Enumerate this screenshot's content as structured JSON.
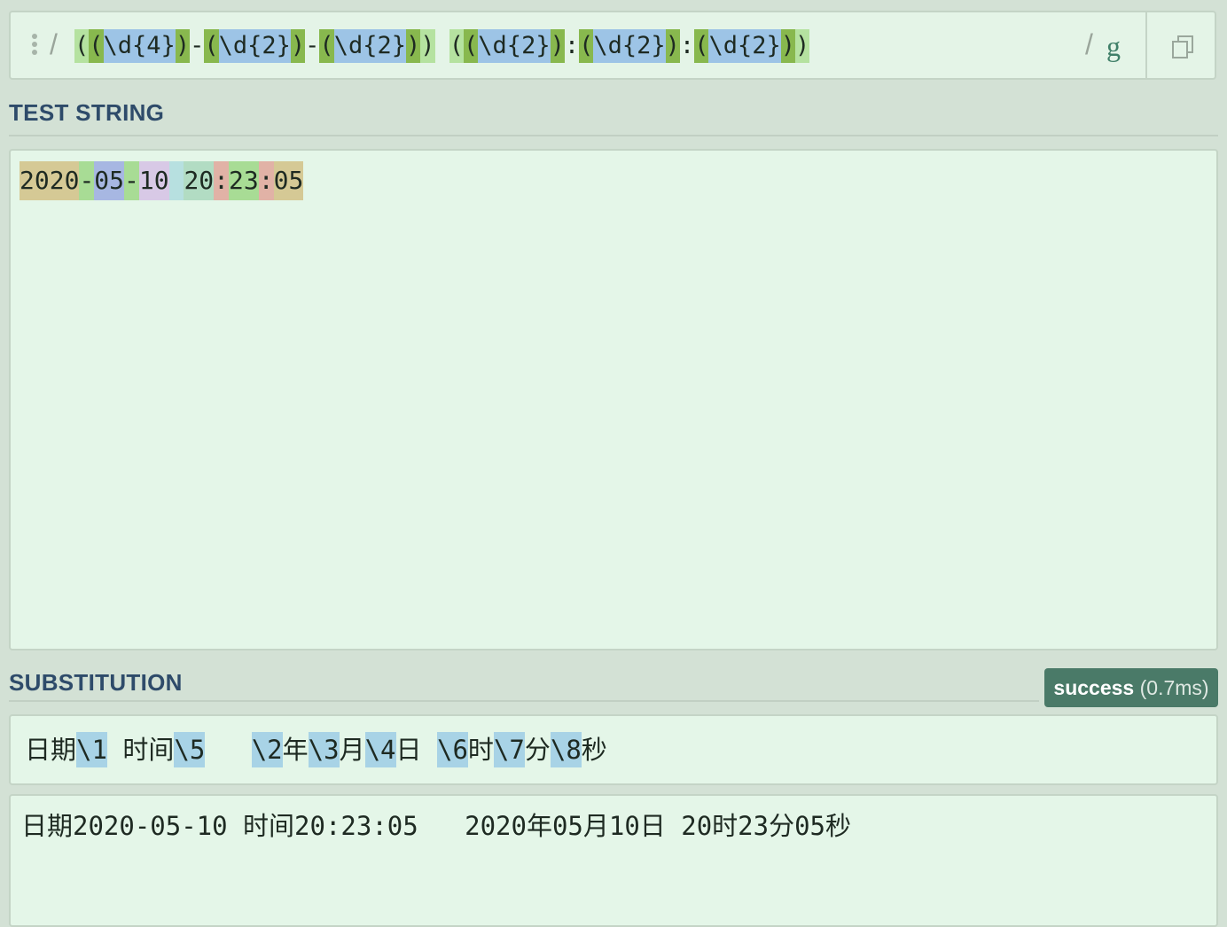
{
  "regex": {
    "open_delimiter": "/",
    "close_delimiter": "/",
    "flags": "g",
    "tokens": [
      {
        "text": "(",
        "kind": "outer"
      },
      {
        "text": "(",
        "kind": "inner"
      },
      {
        "text": "\\d{4}",
        "kind": "body"
      },
      {
        "text": ")",
        "kind": "inner"
      },
      {
        "text": "-",
        "kind": "lit"
      },
      {
        "text": "(",
        "kind": "inner"
      },
      {
        "text": "\\d{2}",
        "kind": "body"
      },
      {
        "text": ")",
        "kind": "inner"
      },
      {
        "text": "-",
        "kind": "lit"
      },
      {
        "text": "(",
        "kind": "inner"
      },
      {
        "text": "\\d{2}",
        "kind": "body"
      },
      {
        "text": ")",
        "kind": "inner"
      },
      {
        "text": ")",
        "kind": "outer"
      },
      {
        "text": " ",
        "kind": "lit"
      },
      {
        "text": "(",
        "kind": "outer"
      },
      {
        "text": "(",
        "kind": "inner"
      },
      {
        "text": "\\d{2}",
        "kind": "body"
      },
      {
        "text": ")",
        "kind": "inner"
      },
      {
        "text": ":",
        "kind": "lit"
      },
      {
        "text": "(",
        "kind": "inner"
      },
      {
        "text": "\\d{2}",
        "kind": "body"
      },
      {
        "text": ")",
        "kind": "inner"
      },
      {
        "text": ":",
        "kind": "lit"
      },
      {
        "text": "(",
        "kind": "inner"
      },
      {
        "text": "\\d{2}",
        "kind": "body"
      },
      {
        "text": ")",
        "kind": "inner"
      },
      {
        "text": ")",
        "kind": "outer"
      }
    ]
  },
  "test_string": {
    "title": "TEST STRING",
    "segments": [
      {
        "text": "2020",
        "color": "khaki"
      },
      {
        "text": "-",
        "color": "green"
      },
      {
        "text": "05",
        "color": "blue"
      },
      {
        "text": "-",
        "color": "green"
      },
      {
        "text": "10",
        "color": "lilac"
      },
      {
        "text": " ",
        "color": "cyan"
      },
      {
        "text": "20",
        "color": "teal"
      },
      {
        "text": ":",
        "color": "red"
      },
      {
        "text": "23",
        "color": "green"
      },
      {
        "text": ":",
        "color": "red"
      },
      {
        "text": "05",
        "color": "khaki"
      }
    ]
  },
  "substitution": {
    "title": "SUBSTITUTION",
    "status_label": "success",
    "status_time": "(0.7ms)",
    "pattern_segments": [
      {
        "text": "日期",
        "ref": false
      },
      {
        "text": "\\1",
        "ref": true
      },
      {
        "text": " 时间",
        "ref": false
      },
      {
        "text": "\\5",
        "ref": true
      },
      {
        "text": "   ",
        "ref": false
      },
      {
        "text": "\\2",
        "ref": true
      },
      {
        "text": "年",
        "ref": false
      },
      {
        "text": "\\3",
        "ref": true
      },
      {
        "text": "月",
        "ref": false
      },
      {
        "text": "\\4",
        "ref": true
      },
      {
        "text": "日 ",
        "ref": false
      },
      {
        "text": "\\6",
        "ref": true
      },
      {
        "text": "时",
        "ref": false
      },
      {
        "text": "\\7",
        "ref": true
      },
      {
        "text": "分",
        "ref": false
      },
      {
        "text": "\\8",
        "ref": true
      },
      {
        "text": "秒",
        "ref": false
      }
    ],
    "result": "日期2020-05-10 时间20:23:05   2020年05月10日 20时23分05秒"
  },
  "icons": {
    "drag": "drag-handle-icon",
    "copy": "copy-icon"
  }
}
